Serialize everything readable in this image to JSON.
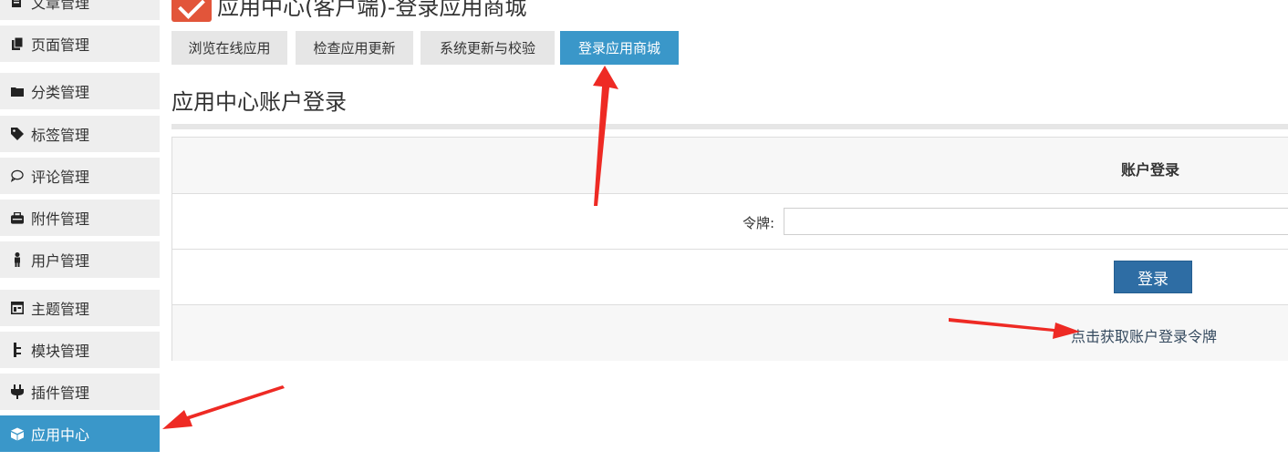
{
  "sidebar": {
    "items": [
      {
        "label": "文章管理",
        "icon": "article-icon"
      },
      {
        "label": "页面管理",
        "icon": "page-icon"
      },
      {
        "label": "分类管理",
        "icon": "folder-icon"
      },
      {
        "label": "标签管理",
        "icon": "tag-icon"
      },
      {
        "label": "评论管理",
        "icon": "comment-icon"
      },
      {
        "label": "附件管理",
        "icon": "attachment-icon"
      },
      {
        "label": "用户管理",
        "icon": "user-icon"
      },
      {
        "label": "主题管理",
        "icon": "theme-icon"
      },
      {
        "label": "模块管理",
        "icon": "module-icon"
      },
      {
        "label": "插件管理",
        "icon": "plugin-icon"
      },
      {
        "label": "应用中心",
        "icon": "app-center-icon",
        "active": true
      }
    ]
  },
  "header": {
    "title": "应用中心(客户端)-登录应用商城"
  },
  "tabs": [
    {
      "label": "浏览在线应用"
    },
    {
      "label": "检查应用更新"
    },
    {
      "label": "系统更新与校验"
    },
    {
      "label": "登录应用商城",
      "active": true
    }
  ],
  "main": {
    "subtitle": "应用中心账户登录",
    "form": {
      "heading": "账户登录",
      "token_label": "令牌:",
      "token_value": "",
      "login_button": "登录",
      "get_token_link": "点击获取账户登录令牌"
    }
  },
  "colors": {
    "accent": "#3a97c9",
    "button": "#2e6da4",
    "arrow": "#ee2a24"
  }
}
